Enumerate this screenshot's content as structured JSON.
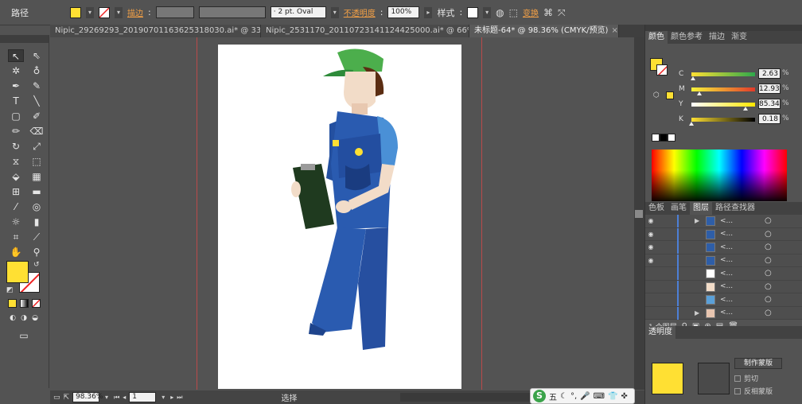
{
  "control_bar": {
    "object_type": "路径",
    "stroke_label": "描边",
    "brush_definition": "· 2 pt. Oval",
    "opacity_label": "不透明度",
    "opacity_value": "100%",
    "style_label": "样式",
    "transform_label": "变换",
    "fill_color": "#ffe033"
  },
  "tabs": [
    {
      "label": "Nipic_29269293_20190701163625318030.ai* @ 33...",
      "close": "×"
    },
    {
      "label": "Nipic_2531170_20110723141124425000.ai* @ 66%...",
      "close": "×"
    },
    {
      "label": "未标题-64* @ 98.36% (CMYK/预览)",
      "close": "×"
    }
  ],
  "status_bar": {
    "zoom": "98.36%",
    "page": "1",
    "mode": "选择"
  },
  "color_panel": {
    "tabs": [
      "颜色",
      "颜色参考",
      "描边",
      "渐变"
    ],
    "channels": [
      {
        "name": "C",
        "value": "2.63",
        "level": 2.63,
        "gradient": "linear-gradient(to right,#ffe033,#2ea84b)"
      },
      {
        "name": "M",
        "value": "12.93",
        "level": 12.93,
        "gradient": "linear-gradient(to right,#f6f43a,#e23a2a)"
      },
      {
        "name": "Y",
        "value": "85.34",
        "level": 85.34,
        "gradient": "linear-gradient(to right,#ffffff,#ffe600)"
      },
      {
        "name": "K",
        "value": "0.18",
        "level": 0.18,
        "gradient": "linear-gradient(to right,#ffe033,#000000)"
      }
    ],
    "pct": "%"
  },
  "layers_panel": {
    "tabs": [
      "色板",
      "画笔",
      "图层",
      "路径查找器"
    ],
    "rows": [
      {
        "name": "<...",
        "thumb": "#2e5ea8"
      },
      {
        "name": "<...",
        "thumb": "#2e5ea8"
      },
      {
        "name": "<...",
        "thumb": "#2e5ea8"
      },
      {
        "name": "<...",
        "thumb": "#2e5ea8"
      },
      {
        "name": "<...",
        "thumb": "#ffffff"
      },
      {
        "name": "<...",
        "thumb": "#f2dcc8"
      },
      {
        "name": "<...",
        "thumb": "#5aa0d8"
      },
      {
        "name": "<...",
        "thumb": "#e8c5b0"
      }
    ],
    "footer": "1 个图层"
  },
  "transparency_panel": {
    "title": "透明度",
    "mask_button": "制作蒙版",
    "invert_label": "反相蒙版",
    "clip_label": "剪切"
  },
  "ime": {
    "label": "五"
  }
}
